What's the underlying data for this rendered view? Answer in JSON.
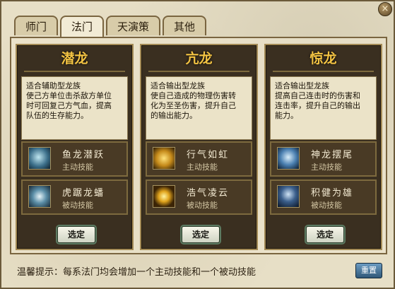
{
  "tabs": [
    "师门",
    "法门",
    "天演策",
    "其他"
  ],
  "active_tab": "法门",
  "close_symbol": "×",
  "columns": [
    {
      "title": "潜龙",
      "desc_lines": [
        "适合辅助型龙族",
        "使己方单位击杀敌方单位",
        "时可回复己方气血，提高",
        "队伍的生存能力。"
      ],
      "skills": [
        {
          "name": "鱼龙潜跃",
          "kind": "主动技能",
          "icon": "dragon-splash-icon"
        },
        {
          "name": "虎踞龙蟠",
          "kind": "被动技能",
          "icon": "coiled-dragon-icon"
        }
      ],
      "select_label": "选定"
    },
    {
      "title": "亢龙",
      "desc_lines": [
        "适合输出型龙族",
        "使自己造成的物理伤害转",
        "化为至圣伤害，提升自己",
        "的输出能力。"
      ],
      "skills": [
        {
          "name": "行气如虹",
          "kind": "主动技能",
          "icon": "golden-dragon-icon"
        },
        {
          "name": "浩气凌云",
          "kind": "被动技能",
          "icon": "golden-swirl-icon"
        }
      ],
      "select_label": "选定"
    },
    {
      "title": "惊龙",
      "desc_lines": [
        "适合输出型龙族",
        "提高自己连击时的伤害和",
        "连击率，提升自己的输出",
        "能力。"
      ],
      "skills": [
        {
          "name": "神龙摆尾",
          "kind": "主动技能",
          "icon": "blue-dragon-icon"
        },
        {
          "name": "积健为雄",
          "kind": "被动技能",
          "icon": "warrior-icon"
        }
      ],
      "select_label": "选定"
    }
  ],
  "footer_tip": "温馨提示：每系法门均会增加一个主动技能和一个被动技能",
  "reset_label": "重置"
}
